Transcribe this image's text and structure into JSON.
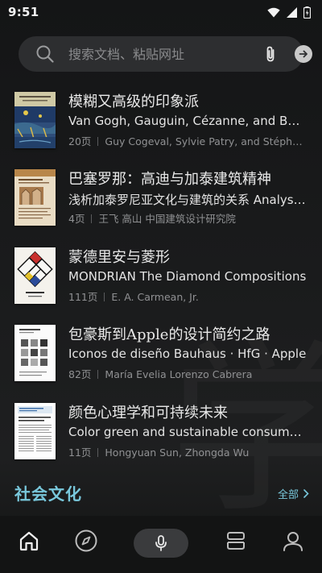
{
  "status": {
    "time": "9:51"
  },
  "search": {
    "placeholder": "搜索文档、粘贴网址"
  },
  "books": [
    {
      "title": "模糊又高级的印象派",
      "subtitle": "Van Gogh, Gauguin, Cézanne, and Beyond...",
      "pages": "20页",
      "authors": "Guy Cogeval, Sylvie Patry, and Stéphane..."
    },
    {
      "title": "巴塞罗那：高迪与加泰建筑精神",
      "subtitle": "浅析加泰罗尼亚文化与建筑的关系 Analysi...",
      "pages": "4页",
      "authors": "王飞 高山 中国建筑设计研究院"
    },
    {
      "title": "蒙德里安与菱形",
      "subtitle": "MONDRIAN The Diamond Compositions",
      "pages": "111页",
      "authors": "E. A. Carmean, Jr."
    },
    {
      "title": "包豪斯到Apple的设计简约之路",
      "subtitle": "Iconos de diseño Bauhaus · HfG · Apple",
      "pages": "82页",
      "authors": "María Evelia Lorenzo Cabrera"
    },
    {
      "title": "颜色心理学和可持续未来",
      "subtitle": "Color green and sustainable consumption...",
      "pages": "11页",
      "authors": "Hongyuan Sun, Zhongda Wu"
    }
  ],
  "section": {
    "title": "社会文化",
    "see_all": "全部"
  },
  "colors": {
    "accent": "#79c8dc",
    "background": "#121314",
    "search_bg": "#2d2e30"
  },
  "nav": [
    "home-icon",
    "compass-icon",
    "microphone-icon",
    "layers-icon",
    "profile-icon"
  ]
}
